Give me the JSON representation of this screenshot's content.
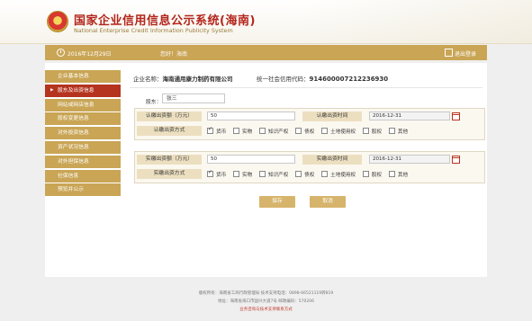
{
  "header": {
    "title": "国家企业信用信息公示系统(海南)",
    "subtitle": "National Enterprise Credit Information Publicity System"
  },
  "topbar": {
    "date": "2016年12月29日",
    "welcome": "您好！海南",
    "logout": "退出登录"
  },
  "sidebar": {
    "items": [
      {
        "label": "企业基本信息",
        "active": false
      },
      {
        "label": "股东及出资信息",
        "active": true
      },
      {
        "label": "网站或网店信息",
        "active": false
      },
      {
        "label": "股权变更信息",
        "active": false
      },
      {
        "label": "对外投资信息",
        "active": false
      },
      {
        "label": "资产状况信息",
        "active": false
      },
      {
        "label": "对外担保信息",
        "active": false
      },
      {
        "label": "社保信息",
        "active": false
      },
      {
        "label": "预览并公示",
        "active": false
      }
    ]
  },
  "company": {
    "name_label": "企业名称：",
    "name": "海南通用康力制药有限公司",
    "code_label": "统一社会信用代码：",
    "code": "914600007212236930"
  },
  "shareholder": {
    "label": "股东：",
    "value": "张三"
  },
  "subscribed": {
    "amount_label": "认缴出资额（万元）",
    "amount_value": "50",
    "date_label": "认缴出资时间",
    "date_value": "2016-12-31",
    "method_label": "认缴出资方式"
  },
  "paid": {
    "amount_label": "实缴出资额（万元）",
    "amount_value": "50",
    "date_label": "实缴出资时间",
    "date_value": "2016-12-31",
    "method_label": "实缴出资方式"
  },
  "methods": [
    "货币",
    "实物",
    "知识产权",
    "债权",
    "土地使用权",
    "股权",
    "其他"
  ],
  "subscribed_checked": [
    "货币"
  ],
  "paid_checked": [
    "货币"
  ],
  "buttons": {
    "save": "保存",
    "cancel": "取消"
  },
  "footer": {
    "line1": "版权所有：海南省工商行政管理局  技术支持电话：0898-66521119转819",
    "line2": "地址：海南省海口市国兴大道7号  邮政编码：570206",
    "line3": "业务咨询与技术支持联系方式"
  }
}
